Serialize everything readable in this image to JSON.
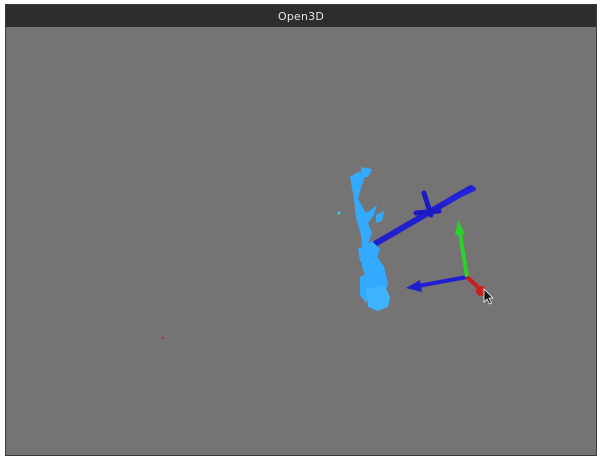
{
  "window": {
    "title": "Open3D"
  },
  "viewport": {
    "background_color": "#757374",
    "objects": [
      {
        "name": "point-cloud",
        "color": "#33aaff"
      },
      {
        "name": "camera-frustum",
        "color": "#1f1fd0"
      },
      {
        "name": "coordinate-frame-x-axis",
        "color": "#c81e1e"
      },
      {
        "name": "coordinate-frame-y-axis",
        "color": "#27d327"
      },
      {
        "name": "coordinate-frame-z-axis",
        "color": "#1f1fd0"
      }
    ],
    "cursor": "arrow-pointer"
  }
}
